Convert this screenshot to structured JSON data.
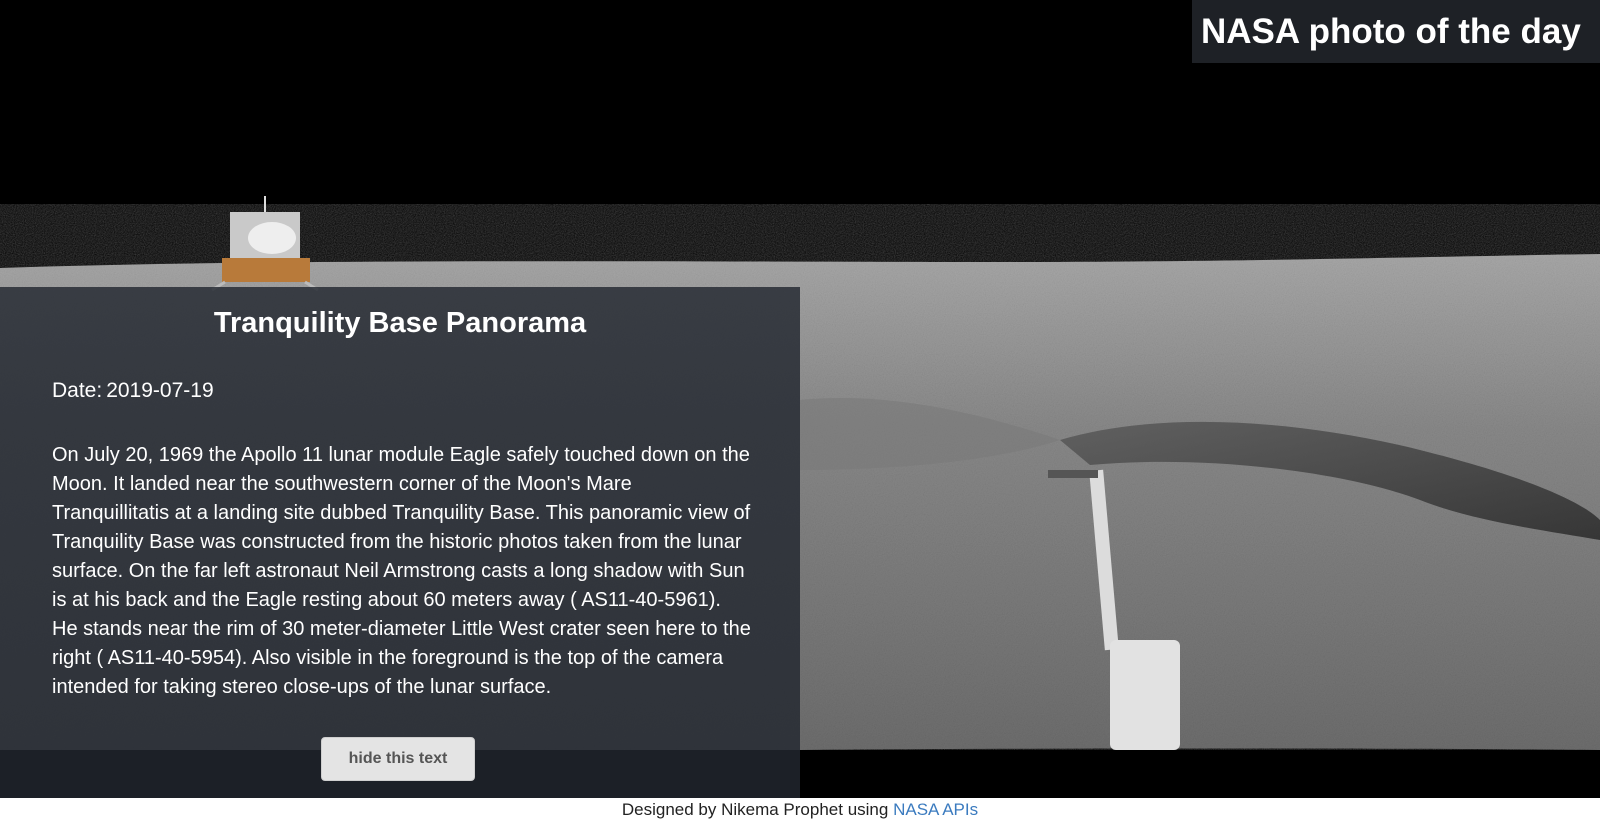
{
  "header": {
    "site_title": "NASA photo of the day"
  },
  "apod": {
    "title": "Tranquility Base Panorama",
    "date_label": "Date:",
    "date": "2019-07-19",
    "explanation": "On July 20, 1969 the Apollo 11 lunar module Eagle safely touched down on the Moon. It landed near the southwestern corner of the Moon's Mare Tranquillitatis at a landing site dubbed Tranquility Base. This panoramic view of Tranquility Base was constructed from the historic photos taken from the lunar surface. On the far left astronaut Neil Armstrong casts a long shadow with Sun is at his back and the Eagle resting about 60 meters away ( AS11-40-5961). He stands near the rim of 30 meter-diameter Little West crater seen here to the right ( AS11-40-5954). Also visible in the foreground is the top of the camera intended for taking stereo close-ups of the lunar surface.",
    "hide_button_label": "hide this text"
  },
  "footer": {
    "prefix": "Designed by Nikema Prophet using",
    "link_text": "NASA APIs"
  },
  "colors": {
    "title_bar_bg": "#1e2126",
    "panel_bg": "#222730",
    "link": "#3b7bbf"
  }
}
